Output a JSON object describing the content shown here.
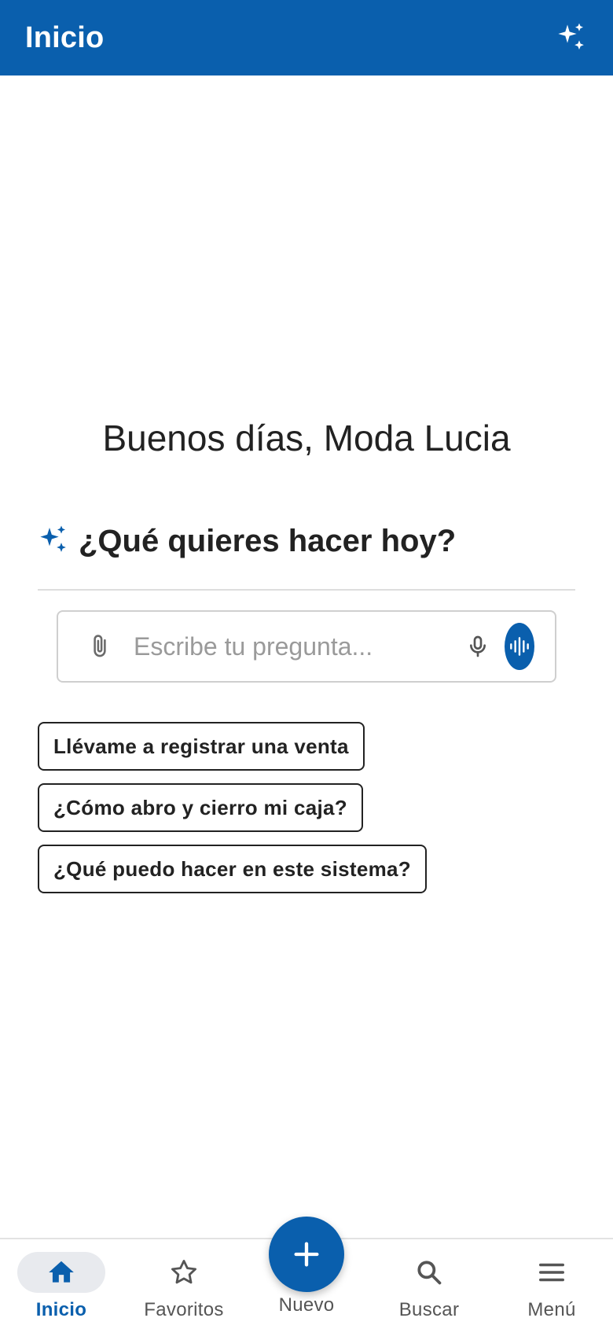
{
  "appbar": {
    "title": "Inicio",
    "ai_icon": "sparkles-icon"
  },
  "greeting": "Buenos días, Moda Lucia",
  "assistant": {
    "heading": "¿Qué quieres hacer hoy?",
    "heading_icon": "sparkles-icon",
    "input": {
      "placeholder": "Escribe tu pregunta...",
      "value": ""
    },
    "attach_icon": "paperclip-icon",
    "mic_icon": "microphone-icon",
    "voice_icon": "audio-wave-icon"
  },
  "suggestions": [
    {
      "label": "Llévame a registrar una venta"
    },
    {
      "label": "¿Cómo abro y cierro mi caja?"
    },
    {
      "label": "¿Qué puedo hacer en este sistema?"
    }
  ],
  "bottom_nav": {
    "items": [
      {
        "label": "Inicio",
        "icon": "home-icon",
        "active": true
      },
      {
        "label": "Favoritos",
        "icon": "star-icon",
        "active": false
      },
      {
        "label": "Nuevo",
        "icon": "plus-icon",
        "active": false
      },
      {
        "label": "Buscar",
        "icon": "search-icon",
        "active": false
      },
      {
        "label": "Menú",
        "icon": "hamburger-menu-icon",
        "active": false
      }
    ]
  },
  "colors": {
    "primary": "#0a5fad",
    "text": "#222222",
    "muted": "#9a9a9a"
  }
}
